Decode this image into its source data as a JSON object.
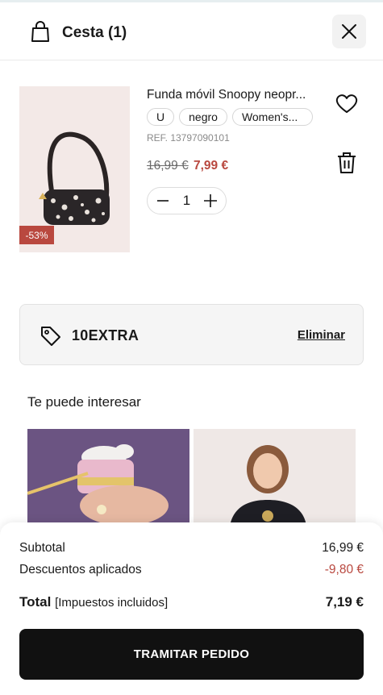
{
  "header": {
    "title": "Cesta (1)",
    "bag_icon": "shopping-bag-icon",
    "close_icon": "close-icon"
  },
  "product": {
    "name": "Funda móvil Snoopy neopr...",
    "chips": [
      "U",
      "negro",
      "Women's..."
    ],
    "ref": "REF. 13797090101",
    "price_old": "16,99 €",
    "price_new": "7,99 €",
    "discount": "-53%",
    "quantity": "1",
    "icons": [
      "heart-icon",
      "trash-icon",
      "minus-icon",
      "plus-icon"
    ]
  },
  "promo": {
    "code": "10EXTRA",
    "remove_label": "Eliminar",
    "icon": "tag-icon"
  },
  "suggestions": {
    "title": "Te puede interesar"
  },
  "summary": {
    "subtotal_label": "Subtotal",
    "subtotal_value": "16,99 €",
    "discount_label": "Descuentos aplicados",
    "discount_value": "-9,80 €",
    "total_label": "Total",
    "total_note": "[Impuestos incluidos]",
    "total_value": "7,19 €",
    "checkout_label": "TRAMITAR PEDIDO"
  },
  "colors": {
    "accent_red": "#b9483f",
    "button_black": "#111111"
  }
}
